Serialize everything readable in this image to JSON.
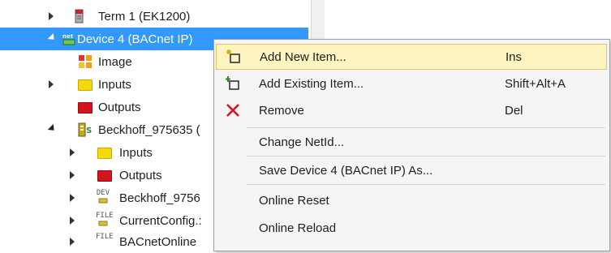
{
  "tree": {
    "rows": [
      {
        "label": "Term 1 (EK1200)",
        "expander": "collapsed",
        "icon": "terminal-icon"
      },
      {
        "label": "Device 4 (BACnet IP)",
        "expander": "expanded",
        "icon": "network-device-icon",
        "selected": true
      },
      {
        "label": "Image",
        "expander": "none",
        "icon": "image-icon"
      },
      {
        "label": "Inputs",
        "expander": "collapsed",
        "icon": "inputs-icon"
      },
      {
        "label": "Outputs",
        "expander": "none",
        "icon": "outputs-icon"
      },
      {
        "label": "Beckhoff_975635 (",
        "expander": "expanded",
        "icon": "device-icon"
      },
      {
        "label": "Inputs",
        "expander": "collapsed",
        "icon": "inputs-icon"
      },
      {
        "label": "Outputs",
        "expander": "collapsed",
        "icon": "outputs-icon"
      },
      {
        "label": "Beckhoff_9756",
        "expander": "collapsed",
        "icon": "dev-file-icon",
        "icon_text": "DEV"
      },
      {
        "label": "CurrentConfig.:",
        "expander": "collapsed",
        "icon": "file-icon",
        "icon_text": "FILE"
      },
      {
        "label": "BACnetOnline",
        "expander": "collapsed",
        "icon": "file-icon",
        "icon_text": "FILE"
      }
    ]
  },
  "context_menu": {
    "items": [
      {
        "label": "Add New Item...",
        "shortcut": "Ins",
        "icon": "add-new-item-icon",
        "highlighted": true
      },
      {
        "label": "Add Existing Item...",
        "shortcut": "Shift+Alt+A",
        "icon": "add-existing-item-icon"
      },
      {
        "label": "Remove",
        "shortcut": "Del",
        "icon": "remove-icon"
      },
      {
        "label": "Change NetId...",
        "shortcut": ""
      },
      {
        "label": "Save Device 4 (BACnet IP) As...",
        "shortcut": ""
      },
      {
        "label": "Online Reset",
        "shortcut": ""
      },
      {
        "label": "Online Reload",
        "shortcut": ""
      }
    ]
  },
  "colors": {
    "selection": "#3399ff",
    "menu_highlight": "#fdf4bf",
    "remove_red": "#d4141c"
  }
}
